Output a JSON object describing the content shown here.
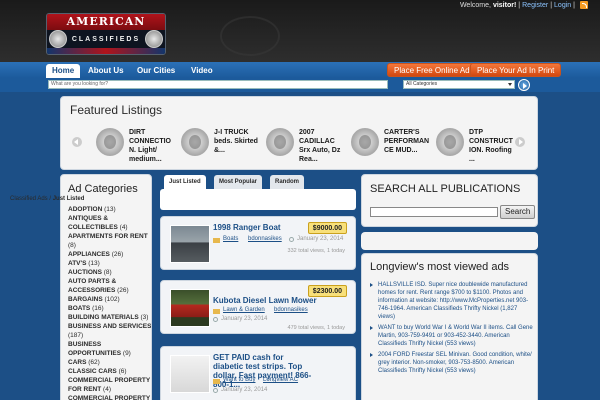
{
  "topbar": {
    "welcome": "Welcome,",
    "user": "visitor!",
    "register": "Register",
    "login": "Login"
  },
  "logo": {
    "title": "AMERICAN",
    "subtitle": "CLASSIFIEDS"
  },
  "nav": {
    "items": [
      "Home",
      "About Us",
      "Our Cities",
      "Video"
    ]
  },
  "cta": {
    "free_ad": "Place Free Online Ad",
    "print_ad": "Place Your Ad In Print"
  },
  "search": {
    "placeholder": "What are you looking for?",
    "category": "All Categories"
  },
  "featured": {
    "title": "Featured Listings",
    "items": [
      "DIRT CONNECTIO N. Light/ medium...",
      "J-I TRUCK beds. Skirted &...",
      "2007 CADILLAC Srx Auto, Dz Rea...",
      "CARTER'S PERFORMAN CE MUD...",
      "DTP CONSTRUCT ION. Roofing ..."
    ]
  },
  "sidebar": {
    "title": "Ad Categories",
    "categories": [
      {
        "name": "ADOPTION",
        "count": "(13)"
      },
      {
        "name": "ANTIQUES &",
        "count": ""
      },
      {
        "name": "COLLECTIBLES",
        "count": "(4)"
      },
      {
        "name": "APARTMENTS FOR RENT",
        "count": ""
      },
      {
        "name": "",
        "count": "(8)"
      },
      {
        "name": "APPLIANCES",
        "count": "(26)"
      },
      {
        "name": "ATV'S",
        "count": "(13)"
      },
      {
        "name": "AUCTIONS",
        "count": "(8)"
      },
      {
        "name": "AUTO PARTS &",
        "count": ""
      },
      {
        "name": "ACCESSORIES",
        "count": "(26)"
      },
      {
        "name": "BARGAINS",
        "count": "(102)"
      },
      {
        "name": "BOATS",
        "count": "(16)"
      },
      {
        "name": "BUILDING MATERIALS",
        "count": "(3)"
      },
      {
        "name": "BUSINESS AND SERVICES",
        "count": ""
      },
      {
        "name": "",
        "count": "(187)"
      },
      {
        "name": "BUSINESS",
        "count": ""
      },
      {
        "name": "OPPORTUNITIES",
        "count": "(9)"
      },
      {
        "name": "CARS",
        "count": "(62)"
      },
      {
        "name": "CLASSIC CARS",
        "count": "(6)"
      },
      {
        "name": "COMMERCIAL PROPERTY",
        "count": ""
      },
      {
        "name": "FOR RENT",
        "count": "(4)"
      },
      {
        "name": "COMMERCIAL PROPERTY",
        "count": ""
      }
    ]
  },
  "tabs": {
    "items": [
      "Just Listed",
      "Most Popular",
      "Random"
    ]
  },
  "crumb": {
    "root": "Classified Ads",
    "sep": " / ",
    "current": "Just Listed"
  },
  "ads": [
    {
      "title": "1998 Ranger Boat",
      "price": "$9000.00",
      "category": "Boats",
      "user": "bdonnasikes",
      "date": "January 23, 2014",
      "views": "332 total views, 1 today"
    },
    {
      "title": "Kubota Diesel Lawn Mower",
      "price": "$2300.00",
      "category": "Lawn & Garden",
      "user": "bdonnasikes",
      "date": "January 23, 2014",
      "views": "479 total views, 1 today"
    },
    {
      "title": "GET PAID cash for diabetic test strips. Top dollar, Fast payment! 866-800-1...",
      "price": "",
      "category": "Want to Buy",
      "user": "Longview AC",
      "date": "January 23, 2014",
      "views": ""
    }
  ],
  "publications": {
    "title": "SEARCH ALL PUBLICATIONS",
    "button": "Search"
  },
  "most_viewed": {
    "title": "Longview's most viewed ads",
    "items": [
      "HALLSVILLE ISD. Super nice doublewide manufactured homes for rent. Rent range $700 to $1100. Photos and information at website: http://www.McProperties.net 903-746-1964. American Classifieds Thrifty Nickel (1,827 views)",
      "WANT to buy World War I & World War II items. Call Gene Martin, 903-759-9491 or 903-452-3440. American Classifieds Thrifty Nickel (553 views)",
      "2004 FORD Freestar SEL Minivan. Good condition, white/ grey interior. Non-smoker, 903-753-8500. American Classifieds Thrifty Nickel (553 views)"
    ]
  }
}
